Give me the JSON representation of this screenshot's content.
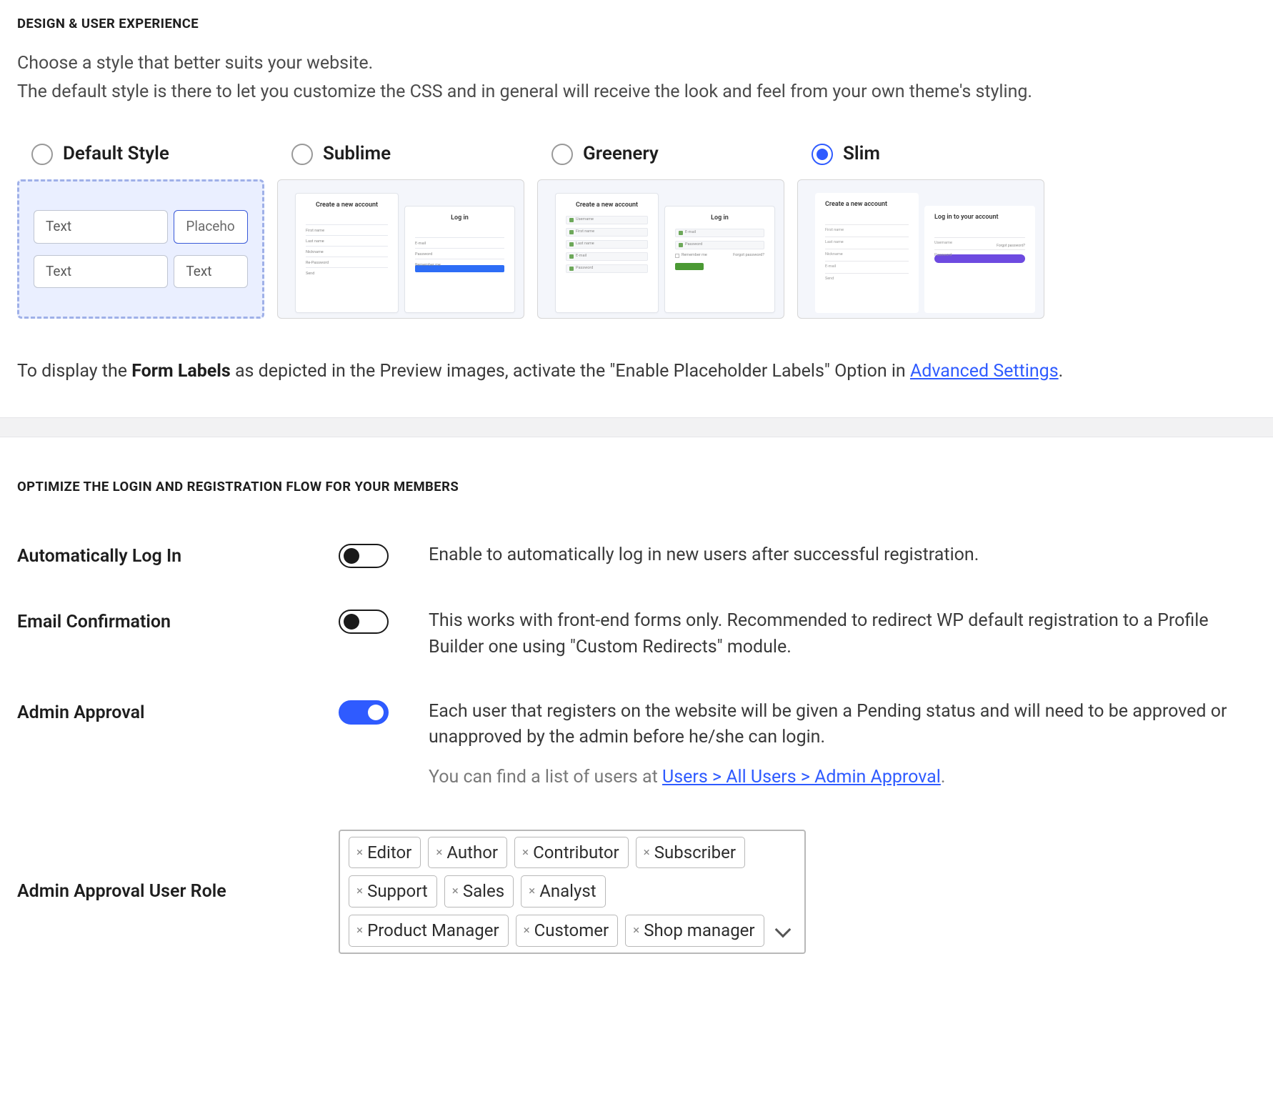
{
  "design": {
    "title": "DESIGN & USER EXPERIENCE",
    "desc_line1": "Choose a style that better suits your website.",
    "desc_line2": "The default style is there to let you customize the CSS and in general will receive the look and feel from your own theme's styling.",
    "options": {
      "default": "Default Style",
      "sublime": "Sublime",
      "greenery": "Greenery",
      "slim": "Slim"
    },
    "preview": {
      "text": "Text",
      "placeholder": "Placeho",
      "create_account": "Create a new account",
      "login": "Log in",
      "login_account": "Log in to your account",
      "first_name": "First name",
      "last_name": "Last name",
      "nickname": "Nickname",
      "repw": "Re-Password",
      "email": "E-mail",
      "username": "Username",
      "password": "Password",
      "remember_me": "Remember me",
      "send": "Send",
      "forgot": "Forgot password?"
    },
    "hint_prefix": "To display the ",
    "hint_strong": "Form Labels",
    "hint_mid": " as depicted in the Preview images, activate the \"Enable Placeholder Labels\" Option in ",
    "hint_link": "Advanced Settings",
    "hint_suffix": "."
  },
  "optimize": {
    "title": "OPTIMIZE THE LOGIN AND REGISTRATION FLOW FOR YOUR MEMBERS",
    "auto_login": {
      "label": "Automatically Log In",
      "desc": "Enable to automatically log in new users after successful registration."
    },
    "email_confirm": {
      "label": "Email Confirmation",
      "desc": "This works with front-end forms only. Recommended to redirect WP default registration to a Profile Builder one using \"Custom Redirects\" module."
    },
    "admin_approval": {
      "label": "Admin Approval",
      "desc": "Each user that registers on the website will be given a Pending status and will need to be approved or unapproved by the admin before he/she can login.",
      "note_prefix": "You can find a list of users at ",
      "note_link": "Users > All Users > Admin Approval",
      "note_suffix": "."
    },
    "admin_approval_role": {
      "label": "Admin Approval User Role",
      "tags": [
        "Editor",
        "Author",
        "Contributor",
        "Subscriber",
        "Support",
        "Sales",
        "Analyst",
        "Product Manager",
        "Customer",
        "Shop manager"
      ]
    }
  }
}
